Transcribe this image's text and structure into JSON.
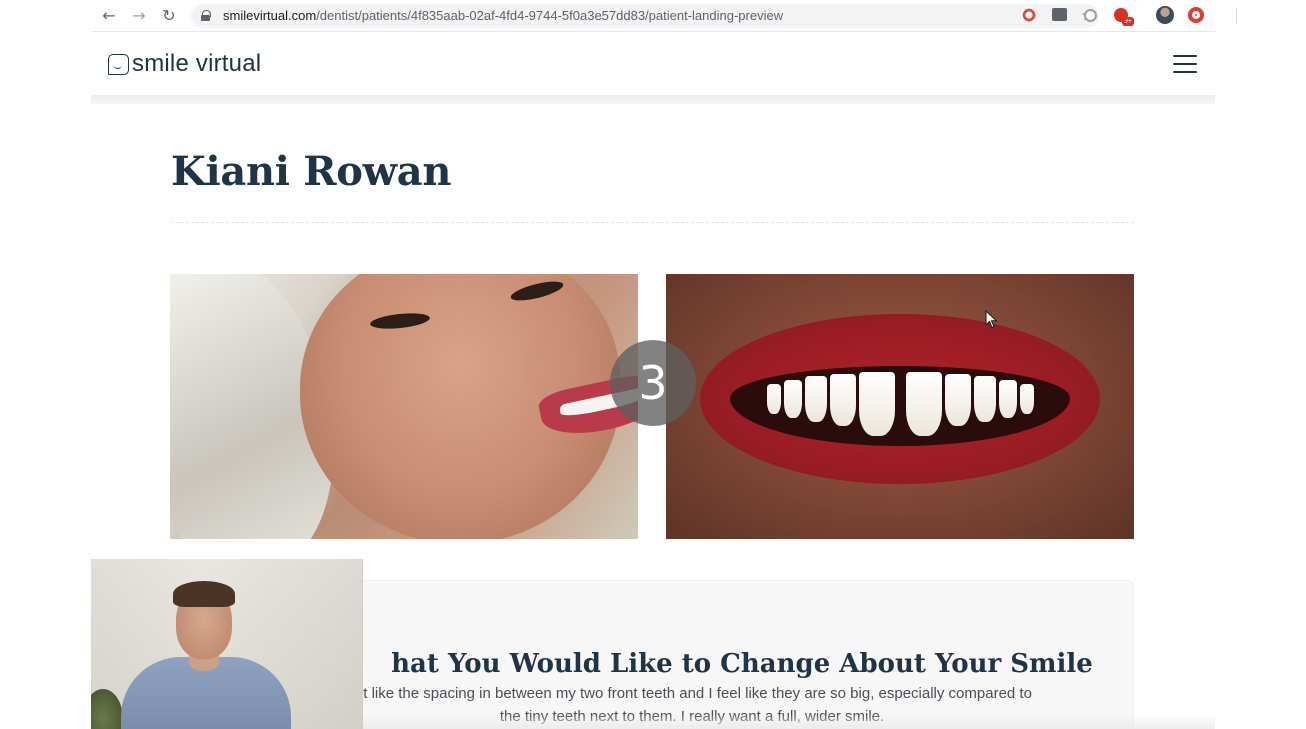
{
  "browser": {
    "url_host": "smilevirtual.com",
    "url_path": "/dentist/patients/4f835aab-02af-4fd4-9744-5f0a3e57dd83/patient-landing-preview",
    "back_icon": "←",
    "forward_icon": "→",
    "reload_icon": "↻",
    "star_icon": "☆",
    "camera_icon": "■",
    "extension_badge": "9+"
  },
  "site": {
    "logo_text": "smile virtual",
    "brand_color": "#1d3347"
  },
  "patient": {
    "name": "Kiani Rowan"
  },
  "slideshow": {
    "counter": "3"
  },
  "card": {
    "title": "hat You Would Like to Change About Your Smile",
    "text": "n't like the spacing in between my two front teeth and I feel like they are so big, especially compared to the tiny teeth next to them. I really want a full, wider smile."
  }
}
